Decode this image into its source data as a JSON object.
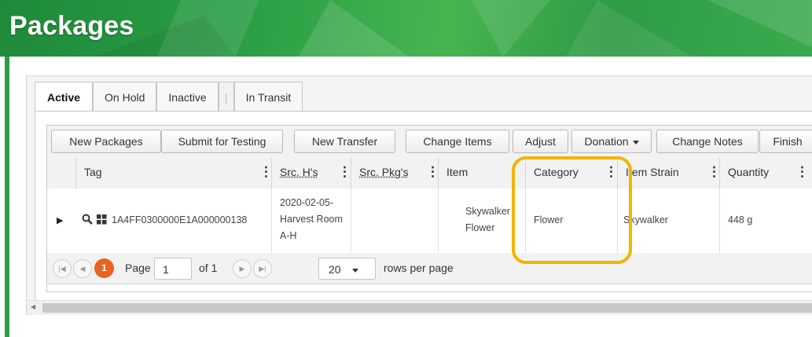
{
  "page": {
    "title": "Packages"
  },
  "tabs": [
    {
      "label": "Active"
    },
    {
      "label": "On Hold"
    },
    {
      "label": "Inactive"
    },
    {
      "label": "|"
    },
    {
      "label": "In Transit"
    }
  ],
  "toolbar": {
    "new_packages": "New Packages",
    "submit_for_testing": "Submit for Testing",
    "new_transfer": "New Transfer",
    "change_items": "Change Items",
    "adjust": "Adjust",
    "donation": "Donation",
    "change_notes": "Change Notes",
    "finish": "Finish"
  },
  "columns": {
    "tag": "Tag",
    "src_hs": "Src. H's",
    "src_pkgs": "Src. Pkg's",
    "item": "Item",
    "category": "Category",
    "item_strain": "Item Strain",
    "quantity": "Quantity"
  },
  "rows": [
    {
      "tag": "1A4FF0300000E1A000000138",
      "src_hs": [
        "2020-02-05-",
        "Harvest Room",
        "A-H"
      ],
      "src_pkgs": "",
      "item": [
        "Skywalker",
        "Flower"
      ],
      "category": "Flower",
      "item_strain": "Skywalker",
      "quantity": "448 g"
    }
  ],
  "pager": {
    "current_page": "1",
    "page_label": "Page",
    "page_value": "1",
    "of_label": "of 1",
    "rows_per_page": "20",
    "rows_per_page_label": "rows per page"
  },
  "colors": {
    "banner": "#2a9e45",
    "current_page_badge": "#e8641f",
    "annotation": "#f4b400"
  },
  "icons": {
    "expand": "caret-right-icon",
    "search": "magnifier-icon",
    "grid": "grid-icon",
    "first": "first-page-icon",
    "prev": "prev-page-icon",
    "next": "next-page-icon",
    "last": "last-page-icon"
  }
}
